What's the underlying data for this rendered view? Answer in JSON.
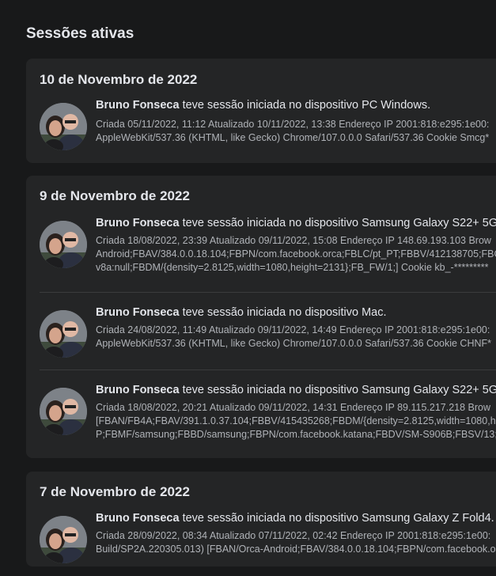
{
  "page_title": "Sessões ativas",
  "groups": [
    {
      "date": "10 de Novembro de 2022",
      "sessions": [
        {
          "name": "Bruno Fonseca",
          "action": "teve sessão iniciada no dispositivo PC Windows.",
          "detail_lines": [
            "Criada 05/11/2022, 11:12 Atualizado 10/11/2022, 13:38 Endereço IP 2001:818:e295:1e00:",
            "AppleWebKit/537.36 (KHTML, like Gecko) Chrome/107.0.0.0 Safari/537.36 Cookie Smcg*"
          ]
        }
      ]
    },
    {
      "date": "9 de Novembro de 2022",
      "sessions": [
        {
          "name": "Bruno Fonseca",
          "action": "teve sessão iniciada no dispositivo Samsung Galaxy S22+ 5G",
          "detail_lines": [
            "Criada 18/08/2022, 23:39 Atualizado 09/11/2022, 15:08 Endereço IP 148.69.193.103 Brow",
            "Android;FBAV/384.0.0.18.104;FBPN/com.facebook.orca;FBLC/pt_PT;FBBV/412138705;FBC",
            "v8a:null;FBDM/{density=2.8125,width=1080,height=2131};FB_FW/1;] Cookie kb_-*********"
          ]
        },
        {
          "name": "Bruno Fonseca",
          "action": "teve sessão iniciada no dispositivo Mac.",
          "detail_lines": [
            "Criada 24/08/2022, 11:49 Atualizado 09/11/2022, 14:49 Endereço IP 2001:818:e295:1e00:",
            "AppleWebKit/537.36 (KHTML, like Gecko) Chrome/107.0.0.0 Safari/537.36 Cookie CHNF*"
          ]
        },
        {
          "name": "Bruno Fonseca",
          "action": "teve sessão iniciada no dispositivo Samsung Galaxy S22+ 5G",
          "detail_lines": [
            "Criada 18/08/2022, 20:21 Atualizado 09/11/2022, 14:31 Endereço IP 89.115.217.218 Brow",
            "[FBAN/FB4A;FBAV/391.1.0.37.104;FBBV/415435268;FBDM/{density=2.8125,width=1080,h",
            "P;FBMF/samsung;FBBD/samsung;FBPN/com.facebook.katana;FBDV/SM-S906B;FBSV/13;F"
          ]
        }
      ]
    },
    {
      "date": "7 de Novembro de 2022",
      "sessions": [
        {
          "name": "Bruno Fonseca",
          "action": "teve sessão iniciada no dispositivo Samsung Galaxy Z Fold4.",
          "detail_lines": [
            "Criada 28/09/2022, 08:34 Atualizado 07/11/2022, 02:42 Endereço IP 2001:818:e295:1e00:",
            "Build/SP2A.220305.013) [FBAN/Orca-Android;FBAV/384.0.0.18.104;FBPN/com.facebook.o"
          ]
        }
      ]
    }
  ]
}
